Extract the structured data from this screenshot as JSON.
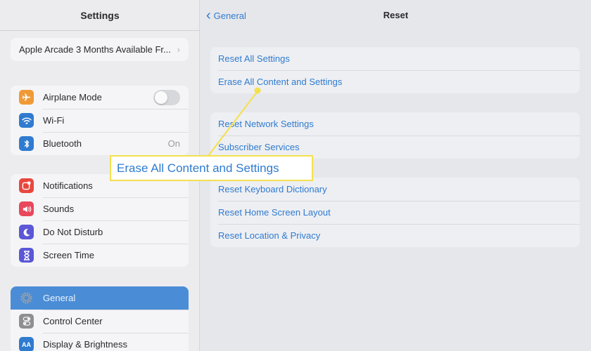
{
  "sidebar": {
    "title": "Settings",
    "promo": {
      "label": "Apple Arcade 3 Months Available Fr...",
      "chevron": "›"
    },
    "group1": [
      {
        "label": "Airplane Mode",
        "icon": "airplane-icon",
        "color": "#f09a37"
      },
      {
        "label": "Wi-Fi",
        "icon": "wifi-icon",
        "color": "#2f7bd0"
      },
      {
        "label": "Bluetooth",
        "icon": "bluetooth-icon",
        "color": "#2f7bd0",
        "value": "On"
      }
    ],
    "group2": [
      {
        "label": "Notifications",
        "icon": "notifications-icon",
        "color": "#e8473f"
      },
      {
        "label": "Sounds",
        "icon": "sounds-icon",
        "color": "#e8475c"
      },
      {
        "label": "Do Not Disturb",
        "icon": "moon-icon",
        "color": "#5b57d6"
      },
      {
        "label": "Screen Time",
        "icon": "hourglass-icon",
        "color": "#5b57d6"
      }
    ],
    "group3": [
      {
        "label": "General",
        "icon": "gear-icon",
        "color": "#8e8e93",
        "selected": true
      },
      {
        "label": "Control Center",
        "icon": "control-center-icon",
        "color": "#8e8e93"
      },
      {
        "label": "Display & Brightness",
        "icon": "display-icon",
        "color": "#2f7bd0",
        "icon_text": "AA"
      }
    ]
  },
  "main": {
    "back_label": "General",
    "title": "Reset",
    "group1": [
      {
        "label": "Reset All Settings"
      },
      {
        "label": "Erase All Content and Settings"
      }
    ],
    "group2": [
      {
        "label": "Reset Network Settings"
      },
      {
        "label": "Subscriber Services"
      }
    ],
    "group3": [
      {
        "label": "Reset Keyboard Dictionary"
      },
      {
        "label": "Reset Home Screen Layout"
      },
      {
        "label": "Reset Location & Privacy"
      }
    ]
  },
  "callout": {
    "label": "Erase All Content and Settings",
    "border_color": "#f4e04d",
    "accent": "#2f7bd0"
  }
}
